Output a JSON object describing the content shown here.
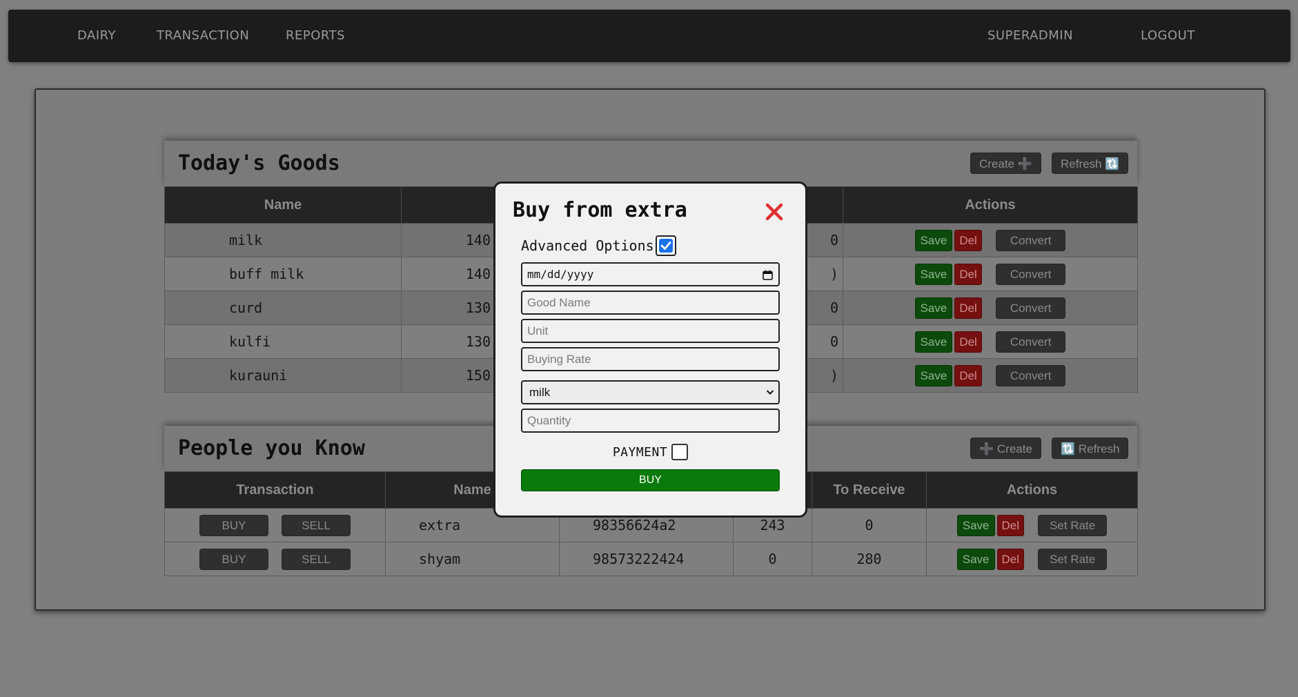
{
  "nav": {
    "left_items": [
      "DAIRY",
      "TRANSACTION",
      "REPORTS"
    ],
    "user": "SUPERADMIN",
    "logout": "LOGOUT"
  },
  "goods": {
    "title": "Today's Goods",
    "create_label": "Create ➕",
    "refresh_label": "Refresh 🔃",
    "columns": [
      "Name",
      "",
      "",
      "Actions"
    ],
    "rows": [
      {
        "name": "milk",
        "value": "140",
        "value2": "0"
      },
      {
        "name": "buff milk",
        "value": "140",
        "value2": ")"
      },
      {
        "name": "curd",
        "value": "130",
        "value2": "0"
      },
      {
        "name": "kulfi",
        "value": "130",
        "value2": "0"
      },
      {
        "name": "kurauni",
        "value": "150",
        "value2": ")"
      }
    ],
    "actions": {
      "save": "Save",
      "del": "Del",
      "convert": "Convert"
    }
  },
  "people": {
    "title": "People you Know",
    "create_label": "➕ Create",
    "refresh_label": "🔃 Refresh",
    "columns": [
      "Transaction",
      "Name",
      "",
      "",
      "To Receive",
      "Actions"
    ],
    "rows": [
      {
        "name": "extra",
        "phone": "98356624a2",
        "to_give": "243",
        "to_receive": "0"
      },
      {
        "name": "shyam",
        "phone": "98573222424",
        "to_give": "0",
        "to_receive": "280"
      }
    ],
    "tx": {
      "buy": "BUY",
      "sell": "SELL"
    },
    "actions": {
      "save": "Save",
      "del": "Del",
      "set_rate": "Set Rate"
    }
  },
  "modal": {
    "title": "Buy from extra",
    "advanced_label": "Advanced Options",
    "advanced_checked": true,
    "date_placeholder": "mm/dd/yyyy",
    "good_name_placeholder": "Good Name",
    "unit_placeholder": "Unit",
    "buying_rate_placeholder": "Buying Rate",
    "selected_good": "milk",
    "quantity_placeholder": "Quantity",
    "payment_label": "PAYMENT",
    "payment_checked": false,
    "buy_label": "BUY"
  },
  "colors": {
    "navbar": "#1c1c1c",
    "save": "#0c4a0c",
    "del": "#751010",
    "buy": "#0a7a0a",
    "close": "#e03030",
    "checkbox": "#1a73e8"
  }
}
